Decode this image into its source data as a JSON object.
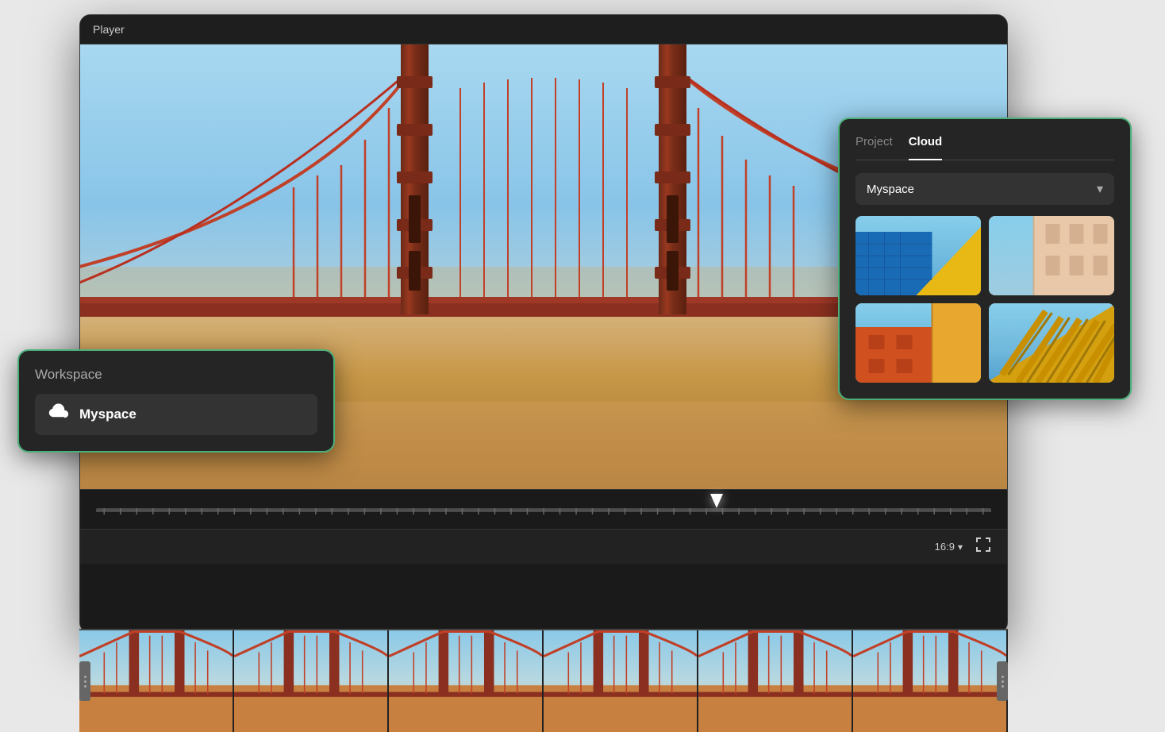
{
  "player": {
    "title": "Player",
    "aspect_ratio": "16:9",
    "aspect_ratio_label": "16:9",
    "fullscreen_icon": "⛶"
  },
  "workspace": {
    "title": "Workspace",
    "item_label": "Myspace",
    "item_icon": "cloud"
  },
  "cloud_panel": {
    "tabs": [
      {
        "label": "Project",
        "active": false
      },
      {
        "label": "Cloud",
        "active": true
      }
    ],
    "dropdown_label": "Myspace",
    "thumbnails": [
      {
        "id": "thumb-1",
        "alt": "Blue building with yellow angle"
      },
      {
        "id": "thumb-2",
        "alt": "Beige building"
      },
      {
        "id": "thumb-3",
        "alt": "Orange building with sky"
      },
      {
        "id": "thumb-4",
        "alt": "Yellow columns with sky"
      }
    ]
  }
}
